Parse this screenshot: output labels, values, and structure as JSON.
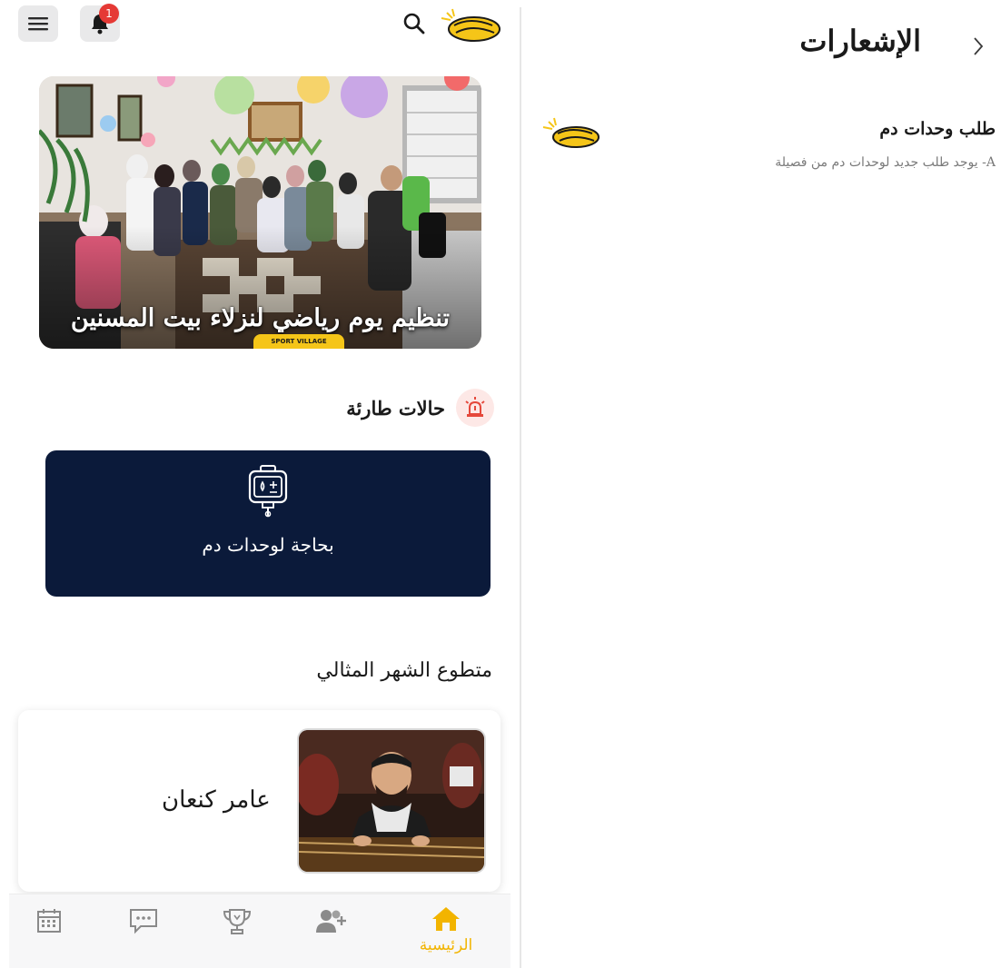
{
  "header": {
    "notification_count": "1"
  },
  "banner": {
    "caption": "تنظيم يوم رياضي لنزلاء بيت المسنين",
    "sport_tag": "SPORT VILLAGE"
  },
  "emergency": {
    "title": "حالات طارئة",
    "card_label": "بحاجة لوحدات دم"
  },
  "volunteer": {
    "title": "متطوع الشهر المثالي",
    "name": "عامر كنعان"
  },
  "bottom_nav": {
    "home_label": "الرئيسية"
  },
  "notifications": {
    "title": "الإشعارات",
    "items": [
      {
        "title": "طلب وحدات دم",
        "body": "A- يوجد طلب جديد لوحدات دم من فصيلة"
      }
    ]
  },
  "colors": {
    "navy": "#0b1a3a",
    "accent_yellow": "#f2b400",
    "badge_red": "#e53935"
  },
  "icons": [
    "menu-icon",
    "bell-icon",
    "search-icon",
    "alarm-icon",
    "blood-bag-icon",
    "home-icon",
    "add-friend-icon",
    "trophy-icon",
    "chat-icon",
    "calendar-icon",
    "chevron-right-icon"
  ]
}
